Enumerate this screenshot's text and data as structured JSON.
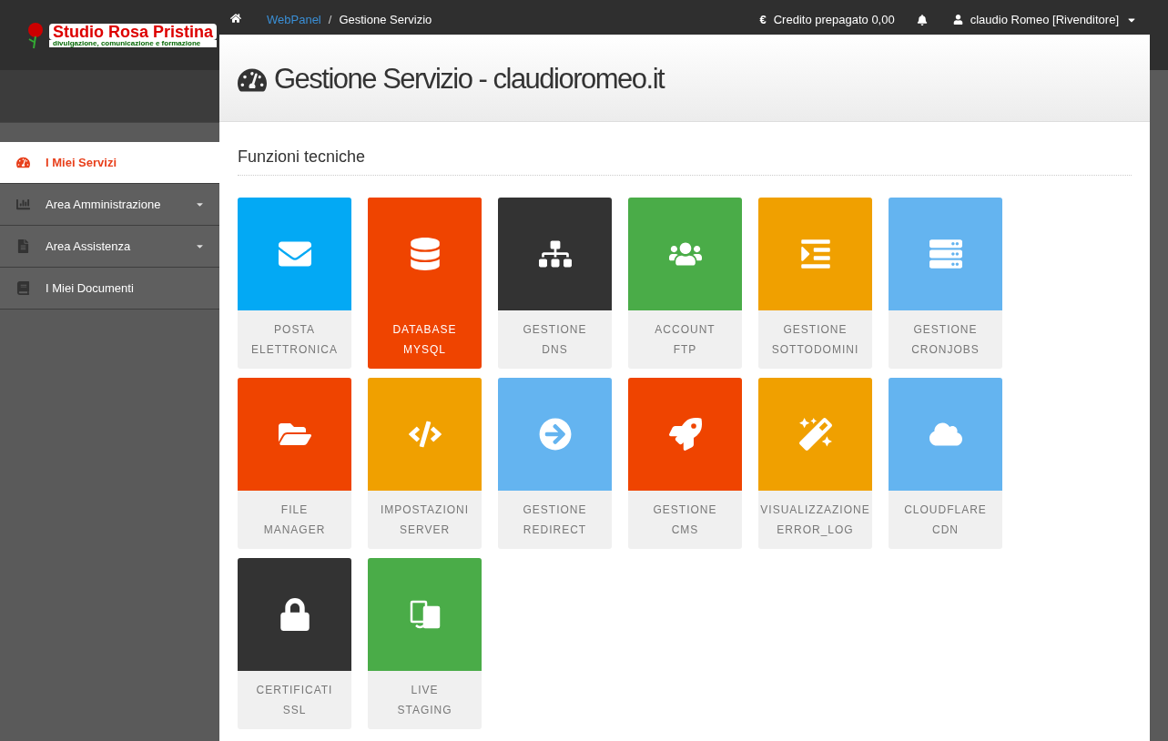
{
  "logo": {
    "title": "Studio Rosa Pristina",
    "tagline": "divulgazione, comunicazione e formazione"
  },
  "breadcrumb": {
    "separator": "/",
    "items": [
      {
        "label": "WebPanel",
        "link": true
      },
      {
        "label": "Gestione Servizio",
        "link": false
      }
    ]
  },
  "topbar": {
    "credit": "Credito prepagato 0,00",
    "currency": "€",
    "user": "claudio Romeo [Rivenditore]"
  },
  "sidebar": {
    "items": [
      {
        "label": "I Miei Servizi",
        "selected": true,
        "has_submenu": false
      },
      {
        "label": "Area Amministrazione",
        "selected": false,
        "has_submenu": true
      },
      {
        "label": "Area Assistenza",
        "selected": false,
        "has_submenu": true
      },
      {
        "label": "I Miei Documenti",
        "selected": false,
        "has_submenu": false
      }
    ]
  },
  "page": {
    "title": "Gestione Servizio - claudioromeo.it",
    "section": "Funzioni tecniche"
  },
  "tiles": [
    {
      "lines": [
        "POSTA",
        "ELETTRONICA"
      ],
      "color": "#03a9f4",
      "selected": false
    },
    {
      "lines": [
        "DATABASE",
        "MYSQL"
      ],
      "color": "#ef4400",
      "selected": true
    },
    {
      "lines": [
        "GESTIONE",
        "DNS"
      ],
      "color": "#333333",
      "selected": false
    },
    {
      "lines": [
        "ACCOUNT",
        "FTP"
      ],
      "color": "#4aac48",
      "selected": false
    },
    {
      "lines": [
        "GESTIONE",
        "SOTTODOMINI"
      ],
      "color": "#f0a000",
      "selected": false
    },
    {
      "lines": [
        "GESTIONE",
        "CRONJOBS"
      ],
      "color": "#64b4f0",
      "selected": false
    },
    {
      "lines": [
        "FILE",
        "MANAGER"
      ],
      "color": "#ef4400",
      "selected": false
    },
    {
      "lines": [
        "IMPOSTAZIONI",
        "SERVER"
      ],
      "color": "#f0a000",
      "selected": false
    },
    {
      "lines": [
        "GESTIONE",
        "REDIRECT"
      ],
      "color": "#64b4f0",
      "selected": false
    },
    {
      "lines": [
        "GESTIONE",
        "CMS"
      ],
      "color": "#ef4400",
      "selected": false
    },
    {
      "lines": [
        "VISUALIZZAZIONE",
        "ERROR_LOG"
      ],
      "color": "#f0a000",
      "selected": false
    },
    {
      "lines": [
        "CLOUDFLARE",
        "CDN"
      ],
      "color": "#64b4f0",
      "selected": false
    },
    {
      "lines": [
        "CERTIFICATI",
        "SSL"
      ],
      "color": "#333333",
      "selected": false
    },
    {
      "lines": [
        "LIVE",
        "STAGING"
      ],
      "color": "#4aac48",
      "selected": false
    }
  ]
}
